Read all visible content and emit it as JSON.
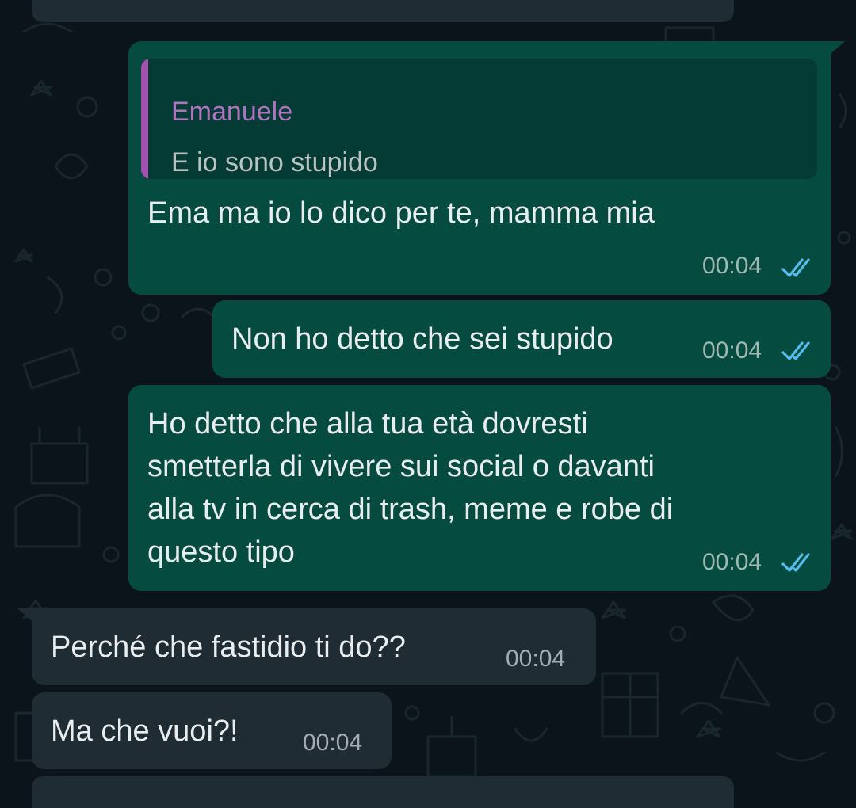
{
  "messages": [
    {
      "id": "m1",
      "direction": "outgoing",
      "quote": {
        "author": "Emanuele",
        "text": "E io sono stupido"
      },
      "text": "Ema ma io lo dico per te, mamma mia",
      "time": "00:04",
      "status": "read"
    },
    {
      "id": "m2",
      "direction": "outgoing",
      "text": "Non ho detto che sei stupido",
      "time": "00:04",
      "status": "read"
    },
    {
      "id": "m3",
      "direction": "outgoing",
      "text": "Ho detto che alla tua età dovresti\nsmetterla di vivere sui social o davanti\nalla tv in cerca di trash, meme e robe di\nquesto tipo",
      "time": "00:04",
      "status": "read"
    },
    {
      "id": "m4",
      "direction": "incoming",
      "text": "Perché che fastidio ti do??",
      "time": "00:04"
    },
    {
      "id": "m5",
      "direction": "incoming",
      "text": "Ma che vuoi?!",
      "time": "00:04"
    }
  ],
  "colors": {
    "background": "#0b141a",
    "outgoing_bubble": "#054b40",
    "incoming_bubble": "#1f2c34",
    "quote_bar": "#a54fae",
    "quote_author": "#b173bf",
    "read_ticks": "#53bdeb"
  },
  "icons": {
    "read_receipt": "double-check-icon"
  }
}
